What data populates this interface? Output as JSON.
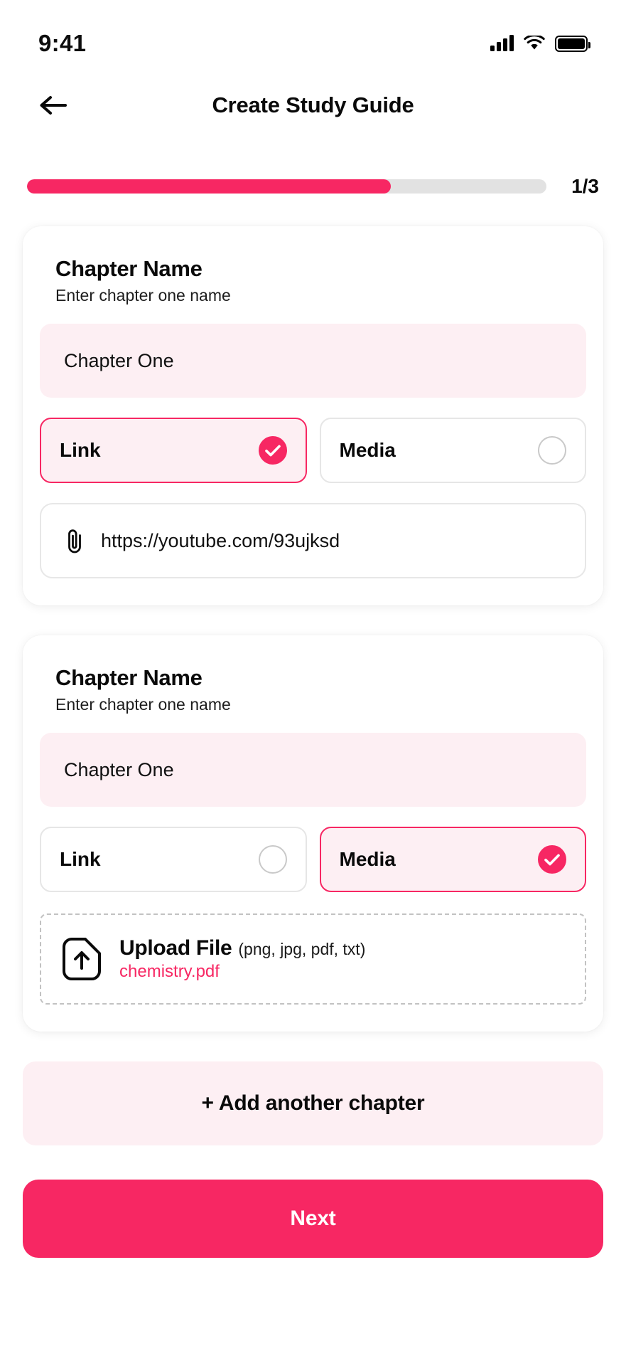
{
  "status_bar": {
    "time": "9:41",
    "signal_icon": "cellular-signal-icon",
    "wifi_icon": "wifi-icon",
    "battery_icon": "battery-full-icon"
  },
  "header": {
    "back_icon": "arrow-left-icon",
    "title": "Create Study Guide"
  },
  "progress": {
    "percent": 70,
    "label": "1/3"
  },
  "theme": {
    "accent": "#F72763",
    "accent_soft": "#FDEFF3",
    "track": "#e2e2e2",
    "border": "#e6e6e6"
  },
  "chapters": [
    {
      "title": "Chapter Name",
      "subtitle": "Enter chapter one name",
      "name_value": "Chapter One",
      "name_placeholder": "Chapter One",
      "options": [
        {
          "label": "Link",
          "selected": true
        },
        {
          "label": "Media",
          "selected": false
        }
      ],
      "link": {
        "icon": "paperclip-icon",
        "value": "https://youtube.com/93ujksd",
        "placeholder": "https://youtube.com/93ujksd"
      }
    },
    {
      "title": "Chapter Name",
      "subtitle": "Enter chapter one name",
      "name_value": "Chapter One",
      "name_placeholder": "Chapter One",
      "options": [
        {
          "label": "Link",
          "selected": false
        },
        {
          "label": "Media",
          "selected": true
        }
      ],
      "upload": {
        "icon": "file-upload-icon",
        "title": "Upload File",
        "formats": "(png, jpg, pdf, txt)",
        "file_name": "chemistry.pdf"
      }
    }
  ],
  "actions": {
    "add_chapter_label": "+ Add another chapter",
    "next_label": "Next"
  }
}
